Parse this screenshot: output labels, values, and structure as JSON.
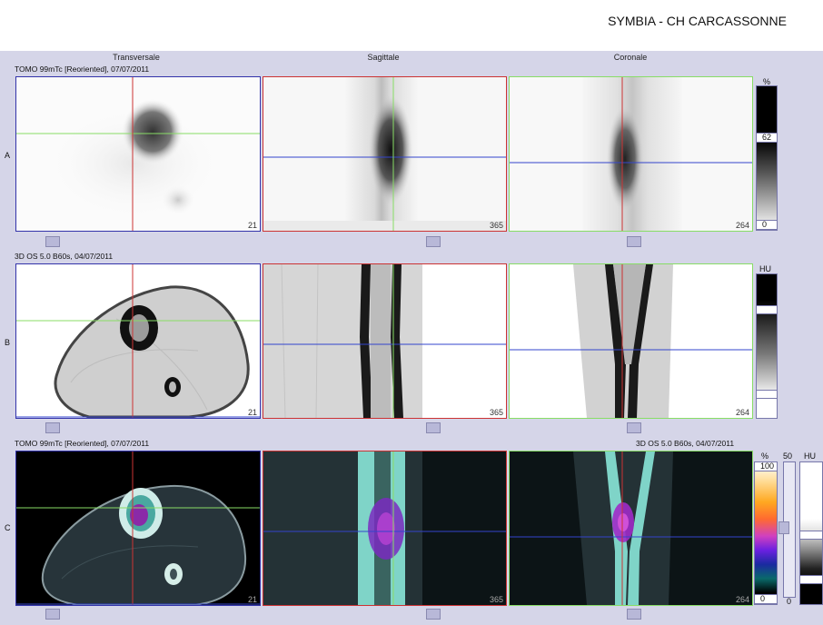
{
  "header": {
    "title": "SYMBIA - CH CARCASSONNE"
  },
  "columns": {
    "transversal": "Transversale",
    "sagittal": "Sagittale",
    "coronal": "Coronale"
  },
  "rows": {
    "a": {
      "label": "A",
      "info": "TOMO 99mTc [Reoriented], 07/07/2011",
      "scale_unit": "%",
      "scale_mid": "62",
      "scale_bottom": "0"
    },
    "b": {
      "label": "B",
      "info": "3D  OS  5.0  B60s, 04/07/2011",
      "scale_unit": "HU"
    },
    "c": {
      "label": "C",
      "info": "TOMO 99mTc [Reoriented], 07/07/2011",
      "info_right": "3D  OS  5.0  B60s, 04/07/2011",
      "scale_unit": "%",
      "scale_top": "100",
      "scale_bottom": "0",
      "scale_extra": "50",
      "scale_unit2": "HU",
      "scale_extra_bottom": "0"
    }
  },
  "slices": {
    "transversal": "21",
    "sagittal": "365",
    "coronal": "264"
  }
}
